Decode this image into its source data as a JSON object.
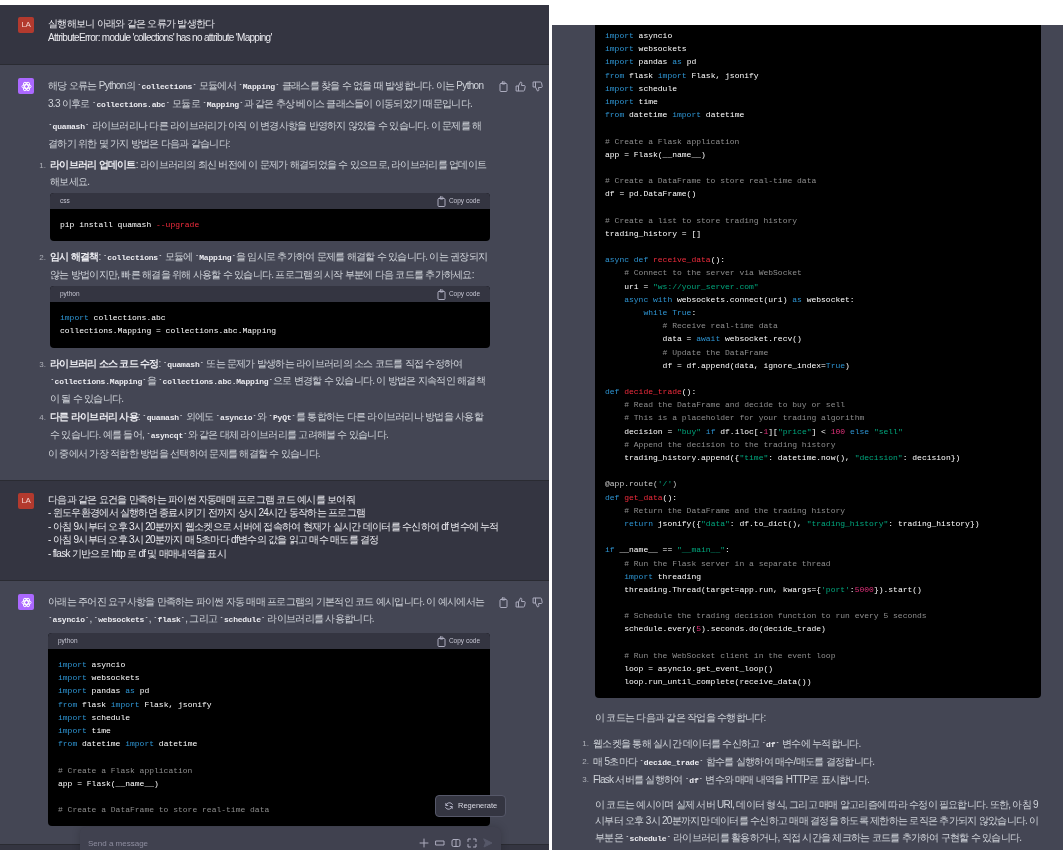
{
  "left_panel": {
    "messages": [
      {
        "kind": "user",
        "avatar": "LA",
        "lines": [
          "실행해보니 아래와 같은 오류가 발생한다",
          "AttributeError: module 'collections' has no attribute 'Mapping'"
        ]
      },
      {
        "kind": "assistant",
        "blocks": [
          {
            "kind": "paragraph",
            "text": "해당 오류는 Python의 **`collections`** 모듈에서 **`Mapping`** 클래스를 찾을 수 없을 때 발생합니다. 이는 Python 3.3 이후로 **`collections.abc`** 모듈로 **`Mapping`**과 같은 추상 베이스 클래스들이 이동되었기 때문입니다."
          },
          {
            "kind": "paragraph",
            "text": "**`quamash`** 라이브러리나 다른 라이브러리가 아직 이 변경사항을 반영하지 않았을 수 있습니다. 이 문제를 해결하기 위한 몇 가지 방법은 다음과 같습니다:"
          },
          {
            "kind": "list",
            "items": [
              {
                "number": "1.",
                "title": "라이브러리 업데이트",
                "text": ": 라이브러리의 최신 버전에 이 문제가 해결되었을 수 있으므로, 라이브러리를 업데이트해보세요.",
                "code": {
                  "language": "css",
                  "copy_label": "Copy code",
                  "groups": [
                    [
                      [
                        {
                          "kind": "plain",
                          "text": "pip install quamash "
                        },
                        {
                          "kind": "flag",
                          "text": "--upgrade"
                        }
                      ]
                    ]
                  ]
                }
              },
              {
                "number": "2.",
                "title": "임시 해결책",
                "text": ": **`collections`** 모듈에 **`Mapping`**을 임시로 추가하여 문제를 해결할 수 있습니다. 이는 권장되지 않는 방법이지만, 빠른 해결을 위해 사용할 수 있습니다. 프로그램의 시작 부분에 다음 코드를 추가하세요:",
                "code": {
                  "language": "python",
                  "copy_label": "Copy code",
                  "groups": [
                    [
                      [
                        {
                          "kind": "keyword",
                          "text": "import"
                        },
                        {
                          "kind": "plain",
                          "text": " collections.abc"
                        }
                      ],
                      [
                        {
                          "kind": "plain",
                          "text": "collections.Mapping = collections.abc.Mapping"
                        }
                      ]
                    ]
                  ]
                }
              },
              {
                "number": "3.",
                "title": "라이브러리 소스 코드 수정",
                "text": ": **`quamash`** 또는 문제가 발생하는 라이브러리의 소스 코드를 직접 수정하여 **`collections.Mapping`**을 **`collections.abc.Mapping`**으로 변경할 수 있습니다. 이 방법은 지속적인 해결책이 될 수 있습니다."
              },
              {
                "number": "4.",
                "title": "다른 라이브러리 사용",
                "text": ": **`quamash`** 외에도 **`asyncio`**와 **`PyQt`**를 통합하는 다른 라이브러리나 방법을 사용할 수 있습니다. 예를 들어, **`asyncqt`**와 같은 대체 라이브러리를 고려해볼 수 있습니다."
              }
            ]
          },
          {
            "kind": "paragraph",
            "text": "이 중에서 가장 적합한 방법을 선택하여 문제를 해결할 수 있습니다."
          }
        ]
      },
      {
        "kind": "user",
        "avatar": "LA",
        "lines": [
          "다음과 같은 요건을 만족하는 파이썬 자동매매 프로그램 코드 예시를 보여줘",
          "- 윈도우환경에서 실행하면 종료시키기 전까지 상시 24시간 동작하는 프로그램",
          "- 아침 9시부터 오후 3시 20분까지 웹소켓으로 서버에 접속하여 현재가 실시간 데이터를 수신하여 df 변수에 누적",
          "- 아침 9시부터 오후 3시 20분까지 매 5초마다 df변수의 값을 읽고 매수 매도를 결정",
          "- flask 기반으로 http 로 df 및 매매내역을 표시"
        ]
      },
      {
        "kind": "assistant",
        "blocks": [
          {
            "kind": "paragraph",
            "text": "아래는 주어진 요구사항을 만족하는 파이썬 자동 매매 프로그램의 기본적인 코드 예시입니다. 이 예시에서는 **`asyncio`**, **`websockets`**, **`flask`**, 그리고 **`schedule`** 라이브러리를 사용합니다."
          },
          {
            "kind": "code",
            "code": {
              "language": "python",
              "copy_label": "Copy code",
              "groups": [
                [
                  [
                    {
                      "kind": "keyword",
                      "text": "import"
                    },
                    {
                      "kind": "plain",
                      "text": " asyncio"
                    }
                  ],
                  [
                    {
                      "kind": "keyword",
                      "text": "import"
                    },
                    {
                      "kind": "plain",
                      "text": " websockets"
                    }
                  ],
                  [
                    {
                      "kind": "keyword",
                      "text": "import"
                    },
                    {
                      "kind": "plain",
                      "text": " pandas "
                    },
                    {
                      "kind": "keyword",
                      "text": "as"
                    },
                    {
                      "kind": "plain",
                      "text": " pd"
                    }
                  ],
                  [
                    {
                      "kind": "keyword",
                      "text": "from"
                    },
                    {
                      "kind": "plain",
                      "text": " flask "
                    },
                    {
                      "kind": "keyword",
                      "text": "import"
                    },
                    {
                      "kind": "plain",
                      "text": " Flask, jsonify"
                    }
                  ],
                  [
                    {
                      "kind": "keyword",
                      "text": "import"
                    },
                    {
                      "kind": "plain",
                      "text": " schedule"
                    }
                  ],
                  [
                    {
                      "kind": "keyword",
                      "text": "import"
                    },
                    {
                      "kind": "plain",
                      "text": " time"
                    }
                  ],
                  [
                    {
                      "kind": "keyword",
                      "text": "from"
                    },
                    {
                      "kind": "plain",
                      "text": " datetime "
                    },
                    {
                      "kind": "keyword",
                      "text": "import"
                    },
                    {
                      "kind": "plain",
                      "text": " datetime"
                    }
                  ]
                ],
                [
                  [
                    {
                      "kind": "comment",
                      "text": "# Create a Flask application"
                    }
                  ],
                  [
                    {
                      "kind": "plain",
                      "text": "app = Flask(__name__)"
                    }
                  ]
                ],
                [
                  [
                    {
                      "kind": "comment",
                      "text": "# Create a DataFrame to store real-time data"
                    }
                  ]
                ]
              ]
            }
          }
        ]
      }
    ],
    "regenerate_label": "Regenerate",
    "composer": {
      "placeholder": "Send a message"
    }
  },
  "right_panel": {
    "code": {
      "groups": [
        [
          [
            {
              "kind": "keyword",
              "text": "import"
            },
            {
              "kind": "plain",
              "text": " asyncio"
            }
          ],
          [
            {
              "kind": "keyword",
              "text": "import"
            },
            {
              "kind": "plain",
              "text": " websockets"
            }
          ],
          [
            {
              "kind": "keyword",
              "text": "import"
            },
            {
              "kind": "plain",
              "text": " pandas "
            },
            {
              "kind": "keyword",
              "text": "as"
            },
            {
              "kind": "plain",
              "text": " pd"
            }
          ],
          [
            {
              "kind": "keyword",
              "text": "from"
            },
            {
              "kind": "plain",
              "text": " flask "
            },
            {
              "kind": "keyword",
              "text": "import"
            },
            {
              "kind": "plain",
              "text": " Flask, jsonify"
            }
          ],
          [
            {
              "kind": "keyword",
              "text": "import"
            },
            {
              "kind": "plain",
              "text": " schedule"
            }
          ],
          [
            {
              "kind": "keyword",
              "text": "import"
            },
            {
              "kind": "plain",
              "text": " time"
            }
          ],
          [
            {
              "kind": "keyword",
              "text": "from"
            },
            {
              "kind": "plain",
              "text": " datetime "
            },
            {
              "kind": "keyword",
              "text": "import"
            },
            {
              "kind": "plain",
              "text": " datetime"
            }
          ]
        ],
        [
          [
            {
              "kind": "comment",
              "text": "# Create a Flask application"
            }
          ],
          [
            {
              "kind": "plain",
              "text": "app = Flask(__name__)"
            }
          ]
        ],
        [
          [
            {
              "kind": "comment",
              "text": "# Create a DataFrame to store real-time data"
            }
          ],
          [
            {
              "kind": "plain",
              "text": "df = pd.DataFrame()"
            }
          ]
        ],
        [
          [
            {
              "kind": "comment",
              "text": "# Create a list to store trading history"
            }
          ],
          [
            {
              "kind": "plain",
              "text": "trading_history = []"
            }
          ]
        ],
        [
          [
            {
              "kind": "keyword",
              "text": "async def "
            },
            {
              "kind": "function",
              "text": "receive_data"
            },
            {
              "kind": "plain",
              "text": "():"
            }
          ],
          [
            {
              "kind": "comment",
              "text": "    # Connect to the server via WebSocket"
            }
          ],
          [
            {
              "kind": "plain",
              "text": "    uri = "
            },
            {
              "kind": "string",
              "text": "\"ws://your_server.com\""
            }
          ],
          [
            {
              "kind": "keyword",
              "text": "    async with "
            },
            {
              "kind": "plain",
              "text": "websockets.connect(uri) "
            },
            {
              "kind": "keyword",
              "text": "as"
            },
            {
              "kind": "plain",
              "text": " websocket:"
            }
          ],
          [
            {
              "kind": "keyword",
              "text": "        while True"
            },
            {
              "kind": "plain",
              "text": ":"
            }
          ],
          [
            {
              "kind": "comment",
              "text": "            # Receive real-time data"
            }
          ],
          [
            {
              "kind": "plain",
              "text": "            data = "
            },
            {
              "kind": "keyword",
              "text": "await"
            },
            {
              "kind": "plain",
              "text": " websocket.recv()"
            }
          ],
          [
            {
              "kind": "comment",
              "text": "            # Update the DataFrame"
            }
          ],
          [
            {
              "kind": "plain",
              "text": "            df = df.append(data, ignore_index="
            },
            {
              "kind": "keyword",
              "text": "True"
            },
            {
              "kind": "plain",
              "text": ")"
            }
          ]
        ],
        [
          [
            {
              "kind": "keyword",
              "text": "def "
            },
            {
              "kind": "function",
              "text": "decide_trade"
            },
            {
              "kind": "plain",
              "text": "():"
            }
          ],
          [
            {
              "kind": "comment",
              "text": "    # Read the DataFrame and decide to buy or sell"
            }
          ],
          [
            {
              "kind": "comment",
              "text": "    # This is a placeholder for your trading algorithm"
            }
          ],
          [
            {
              "kind": "plain",
              "text": "    decision = "
            },
            {
              "kind": "string",
              "text": "\"buy\""
            },
            {
              "kind": "keyword",
              "text": " if "
            },
            {
              "kind": "plain",
              "text": "df.iloc[-"
            },
            {
              "kind": "number",
              "text": "1"
            },
            {
              "kind": "plain",
              "text": "]["
            },
            {
              "kind": "string",
              "text": "\"price\""
            },
            {
              "kind": "plain",
              "text": "] < "
            },
            {
              "kind": "number",
              "text": "100"
            },
            {
              "kind": "keyword",
              "text": " else "
            },
            {
              "kind": "string",
              "text": "\"sell\""
            }
          ],
          [
            {
              "kind": "comment",
              "text": "    # Append the decision to the trading history"
            }
          ],
          [
            {
              "kind": "plain",
              "text": "    trading_history.append({"
            },
            {
              "kind": "string",
              "text": "\"time\""
            },
            {
              "kind": "plain",
              "text": ": datetime.now(), "
            },
            {
              "kind": "string",
              "text": "\"decision\""
            },
            {
              "kind": "plain",
              "text": ": decision})"
            }
          ]
        ],
        [
          [
            {
              "kind": "decorator",
              "text": "@app.route("
            },
            {
              "kind": "string",
              "text": "'/'"
            },
            {
              "kind": "decorator",
              "text": ")"
            }
          ],
          [
            {
              "kind": "keyword",
              "text": "def "
            },
            {
              "kind": "function",
              "text": "get_data"
            },
            {
              "kind": "plain",
              "text": "():"
            }
          ],
          [
            {
              "kind": "comment",
              "text": "    # Return the DataFrame and the trading history"
            }
          ],
          [
            {
              "kind": "keyword",
              "text": "    return "
            },
            {
              "kind": "plain",
              "text": "jsonify({"
            },
            {
              "kind": "string",
              "text": "\"data\""
            },
            {
              "kind": "plain",
              "text": ": df.to_dict(), "
            },
            {
              "kind": "string",
              "text": "\"trading_history\""
            },
            {
              "kind": "plain",
              "text": ": trading_history})"
            }
          ]
        ],
        [
          [
            {
              "kind": "keyword",
              "text": "if "
            },
            {
              "kind": "plain",
              "text": "__name__ == "
            },
            {
              "kind": "string",
              "text": "\"__main__\""
            },
            {
              "kind": "plain",
              "text": ":"
            }
          ],
          [
            {
              "kind": "comment",
              "text": "    # Run the Flask server in a separate thread"
            }
          ],
          [
            {
              "kind": "keyword",
              "text": "    import "
            },
            {
              "kind": "plain",
              "text": "threading"
            }
          ],
          [
            {
              "kind": "plain",
              "text": "    threading.Thread(target=app.run, kwargs={"
            },
            {
              "kind": "string",
              "text": "'port'"
            },
            {
              "kind": "plain",
              "text": ":"
            },
            {
              "kind": "number",
              "text": "5000"
            },
            {
              "kind": "plain",
              "text": "}).start()"
            }
          ]
        ],
        [
          [
            {
              "kind": "comment",
              "text": "    # Schedule the trading decision function to run every 5 seconds"
            }
          ],
          [
            {
              "kind": "plain",
              "text": "    schedule.every("
            },
            {
              "kind": "number",
              "text": "5"
            },
            {
              "kind": "plain",
              "text": ").seconds.do(decide_trade)"
            }
          ]
        ],
        [
          [
            {
              "kind": "comment",
              "text": "    # Run the WebSocket client in the event loop"
            }
          ],
          [
            {
              "kind": "plain",
              "text": "    loop = asyncio.get_event_loop()"
            }
          ],
          [
            {
              "kind": "plain",
              "text": "    loop.run_until_complete(receive_data())"
            }
          ]
        ]
      ]
    },
    "blocks": [
      {
        "kind": "paragraph",
        "text": "이 코드는 다음과 같은 작업을 수행합니다:"
      },
      {
        "kind": "list",
        "items": [
          {
            "number": "1.",
            "text": "웹소켓을 통해 실시간 데이터를 수신하고 **`df`** 변수에 누적합니다."
          },
          {
            "number": "2.",
            "text": "매 5초마다 **`decide_trade`** 함수를 실행하여 매수/매도를 결정합니다."
          },
          {
            "number": "3.",
            "text": "Flask 서버를 실행하여 **`df`** 변수와 매매 내역을 HTTP로 표시합니다."
          }
        ]
      },
      {
        "kind": "paragraph",
        "text": "이 코드는 예시이며 실제 서버 URI, 데이터 형식, 그리고 매매 알고리즘에 따라 수정이 필요합니다. 또한, 아침 9시부터 오후 3시 20분까지만 데이터를 수신하고 매매 결정을 하도록 제한하는 로직은 추가되지 않았습니다. 이 부분은 **`schedule`** 라이브러리를 활용하거나, 직접 시간을 체크하는 코드를 추가하여 구현할 수 있습니다."
      }
    ]
  }
}
